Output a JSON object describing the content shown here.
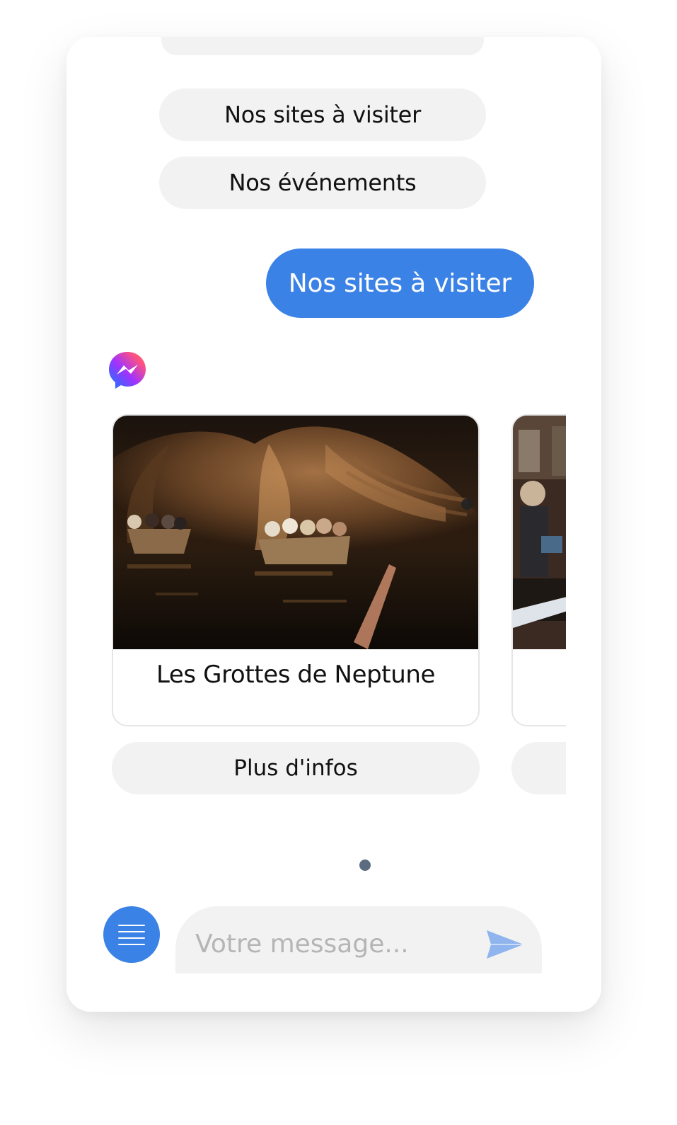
{
  "quick_replies": {
    "items": [
      {
        "label": "Nos sites à visiter"
      },
      {
        "label": "Nos événements"
      }
    ]
  },
  "chat": {
    "user_message": "Nos sites à visiter"
  },
  "carousel": {
    "cards": [
      {
        "title": "Les Grottes de Neptune",
        "button_label": "Plus d'infos"
      },
      {
        "title": "",
        "button_label": ""
      }
    ],
    "page_count": 1
  },
  "composer": {
    "placeholder": "Votre message..."
  },
  "colors": {
    "accent": "#3b82e6",
    "pill_bg": "#f2f2f2",
    "dot": "#5b6b80"
  },
  "icons": {
    "avatar": "messenger-icon",
    "menu": "hamburger-icon",
    "send": "send-icon"
  }
}
